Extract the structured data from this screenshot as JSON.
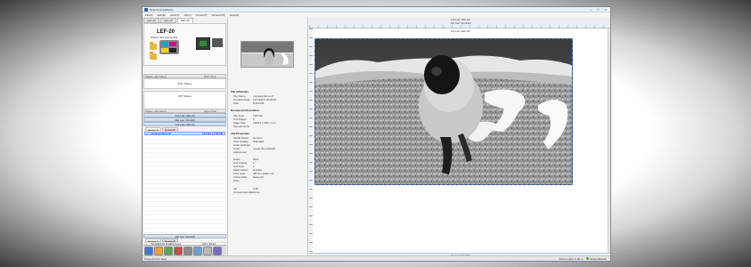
{
  "window": {
    "title": "Roland VersaWorks"
  },
  "menu": [
    "File(F)",
    "Edit(E)",
    "View(V)",
    "Job(J)",
    "Printer(P)",
    "Window(W)",
    "Help(H)"
  ],
  "printer_tabs": [
    "LEF-20",
    "LEF-20",
    "LEF-20"
  ],
  "printer": {
    "model": "LEF-20",
    "status": "Status: Not Connected"
  },
  "ink_colors": [
    "#00a6d6",
    "#d6008a",
    "#f2d500",
    "#222222",
    "#ffffff",
    "#c9c9c9"
  ],
  "print_status_panel": {
    "col1": "Status",
    "col2": "Job Name",
    "col3": "Print Time",
    "label": "Print Status"
  },
  "rip_status_panel": {
    "label": "RIP Status"
  },
  "queue_header": {
    "col1": "Status",
    "col2": "Job Name",
    "col3": "Input Time"
  },
  "queue_info": {
    "line1": "Job List: LEF-20",
    "line2": "Job List: VG-640",
    "line3": "Job List: LEF-20"
  },
  "queue_tabs": [
    "Queue A",
    "Queue B"
  ],
  "selected_job": {
    "name": "monkeyinferno.tif",
    "time": "12/7/14 11:56 AM"
  },
  "bottom_list": {
    "bar": "Job List: VG-640",
    "tab_a": "Queue A",
    "tab_b": "Queue B",
    "file": "VersaWorks TestPrint.eps",
    "time": "2/6/7 15:21"
  },
  "file_attributes": {
    "title": "File Attributes",
    "rows": [
      {
        "k": "File Name",
        "v": "monkeyinferno.tif"
      },
      {
        "k": "Creation Date",
        "v": "12/7/2014 18:28:08"
      },
      {
        "k": "Size",
        "v": "8,404 KB"
      }
    ]
  },
  "document_info": {
    "title": "Document Information",
    "rows": [
      {
        "k": "File Type",
        "v": "TIFF file"
      },
      {
        "k": "# of Pages",
        "v": "1"
      },
      {
        "k": "Page Size",
        "v": "1296.9 x 692.1 mm"
      },
      {
        "k": "Special Items",
        "v": ""
      }
    ]
  },
  "job_properties": {
    "title": "Job Properties",
    "rows": [
      {
        "k": "Media Name",
        "v": "Generic"
      },
      {
        "k": "Print Quality",
        "v": "Standard"
      },
      {
        "k": "Color Settings",
        "v": ""
      },
      {
        "k": "Color Adjustment",
        "v": "Linear (Not Edited)"
      },
      {
        "k": "",
        "v": ""
      },
      {
        "k": "Scale",
        "v": "30%"
      },
      {
        "k": "# of Copies",
        "v": "1"
      },
      {
        "k": "# of Tiles",
        "v": "1"
      },
      {
        "k": "Mark Option",
        "v": "Disable"
      },
      {
        "k": "Print Area",
        "v": "387.9 x 208.0 mm"
      },
      {
        "k": "Action After Print",
        "v": "Save job"
      },
      {
        "k": "",
        "v": ""
      },
      {
        "k": "Ink Consumption(Estimat...",
        "v": "0.38"
      }
    ]
  },
  "canvas": {
    "ruler_top_1": "Job List: LEF-20",
    "ruler_top_2": "Job List: VG-640",
    "ruler_top_3": "Job List: LEF-20",
    "ruler_bottom": "Job List: VG-640"
  },
  "statusbar": {
    "left": "Press [F1] for Help",
    "total": "Total Length: 0.00 m",
    "brand": "RolandDGNet"
  }
}
